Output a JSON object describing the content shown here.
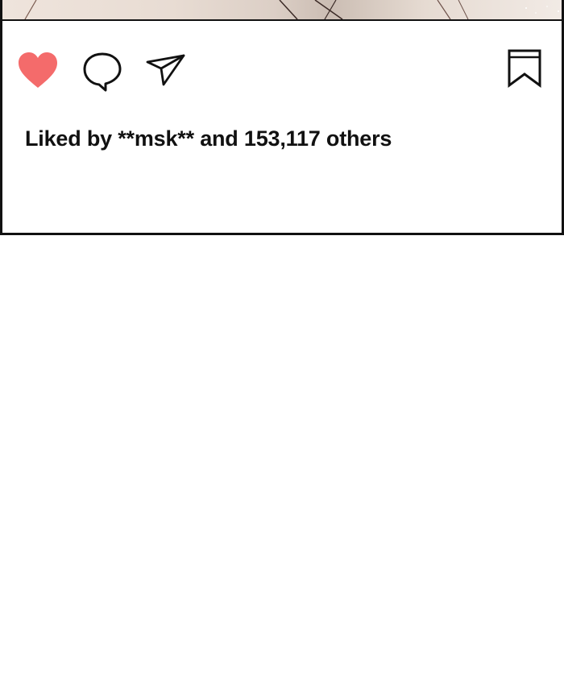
{
  "post": {
    "likes_text": "Liked by **msk** and 153,117 others",
    "heart_color": "#f46b6b"
  },
  "icons": {
    "like": "heart-icon",
    "comment": "speech-bubble-icon",
    "share": "paper-plane-icon",
    "save": "bookmark-icon"
  }
}
